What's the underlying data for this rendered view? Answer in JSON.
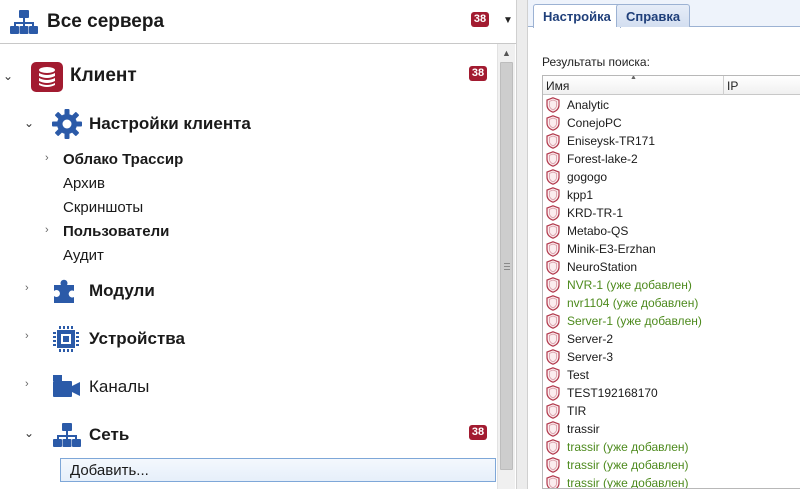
{
  "header": {
    "title": "Все сервера",
    "badge": "38"
  },
  "tree": {
    "client": {
      "label": "Клиент",
      "badge": "38"
    },
    "client_settings": {
      "label": "Настройки клиента"
    },
    "settings_items": [
      {
        "label": "Облако Трассир",
        "bold": true,
        "expandable": true
      },
      {
        "label": "Архив",
        "bold": false,
        "expandable": false
      },
      {
        "label": "Скриншоты",
        "bold": false,
        "expandable": false
      },
      {
        "label": "Пользователи",
        "bold": true,
        "expandable": true
      },
      {
        "label": "Аудит",
        "bold": false,
        "expandable": false
      }
    ],
    "modules": {
      "label": "Модули"
    },
    "devices": {
      "label": "Устройства"
    },
    "channels": {
      "label": "Каналы"
    },
    "network": {
      "label": "Сеть",
      "badge": "38"
    },
    "add_item": {
      "label": "Добавить..."
    }
  },
  "tabs": [
    {
      "label": "Настройка",
      "active": true
    },
    {
      "label": "Справка",
      "active": false
    }
  ],
  "results": {
    "label": "Результаты поиска:",
    "columns": [
      "Имя",
      "IP"
    ],
    "rows": [
      {
        "name": "Analytic",
        "added": false
      },
      {
        "name": "ConejoPC",
        "added": false
      },
      {
        "name": "Eniseysk-TR171",
        "added": false
      },
      {
        "name": "Forest-lake-2",
        "added": false
      },
      {
        "name": "gogogo",
        "added": false
      },
      {
        "name": "kpp1",
        "added": false
      },
      {
        "name": "KRD-TR-1",
        "added": false
      },
      {
        "name": "Metabo-QS",
        "added": false
      },
      {
        "name": "Minik-E3-Erzhan",
        "added": false
      },
      {
        "name": "NeuroStation",
        "added": false
      },
      {
        "name": "NVR-1 (уже добавлен)",
        "added": true
      },
      {
        "name": "nvr1104 (уже добавлен)",
        "added": true
      },
      {
        "name": "Server-1 (уже добавлен)",
        "added": true
      },
      {
        "name": "Server-2",
        "added": false
      },
      {
        "name": "Server-3",
        "added": false
      },
      {
        "name": "Test",
        "added": false
      },
      {
        "name": "TEST192168170",
        "added": false
      },
      {
        "name": "TIR",
        "added": false
      },
      {
        "name": "trassir",
        "added": false
      },
      {
        "name": "trassir (уже добавлен)",
        "added": true
      },
      {
        "name": "trassir (уже добавлен)",
        "added": true
      },
      {
        "name": "trassir (уже добавлен)",
        "added": true
      }
    ]
  },
  "colors": {
    "badge": "#a21b30",
    "icon_blue": "#2b5aa8",
    "added_text": "#4d8a1d"
  }
}
